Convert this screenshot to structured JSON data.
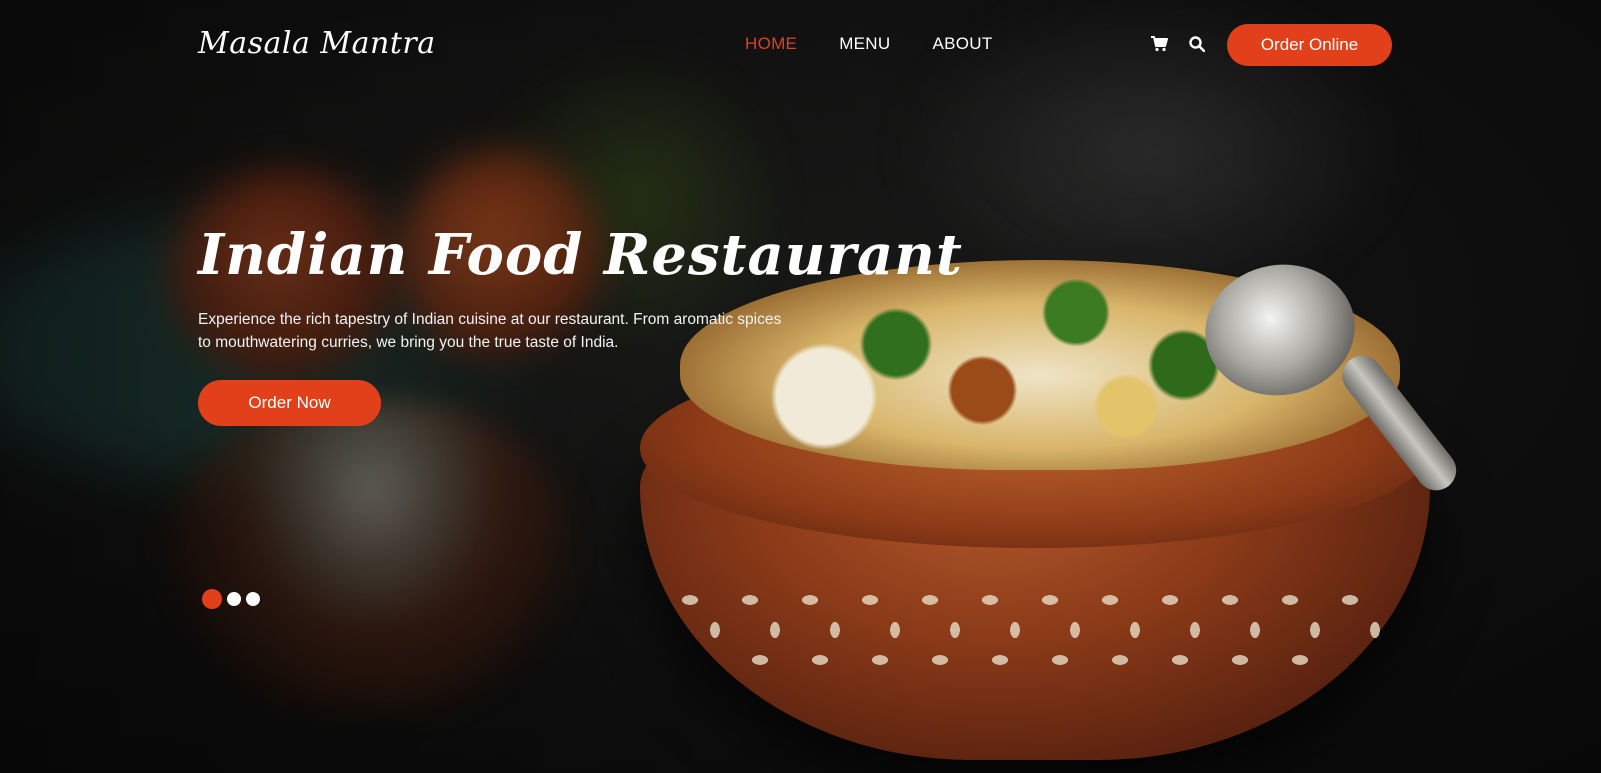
{
  "brand": {
    "name": "Masala Mantra"
  },
  "nav": {
    "items": [
      {
        "label": "HOME",
        "active": true
      },
      {
        "label": "MENU",
        "active": false
      },
      {
        "label": "ABOUT",
        "active": false
      }
    ],
    "cart_icon": "cart-icon",
    "search_icon": "search-icon",
    "cta_label": "Order Online"
  },
  "hero": {
    "title": "Indian Food Restaurant",
    "description": "Experience the rich tapestry of Indian cuisine at our restaurant. From aromatic spices to mouthwatering curries, we bring you the true taste of India.",
    "cta_label": "Order Now",
    "slides": {
      "count": 3,
      "active_index": 0
    }
  },
  "colors": {
    "accent": "#e2401b",
    "text": "#ffffff",
    "background": "#0b0b0b"
  }
}
